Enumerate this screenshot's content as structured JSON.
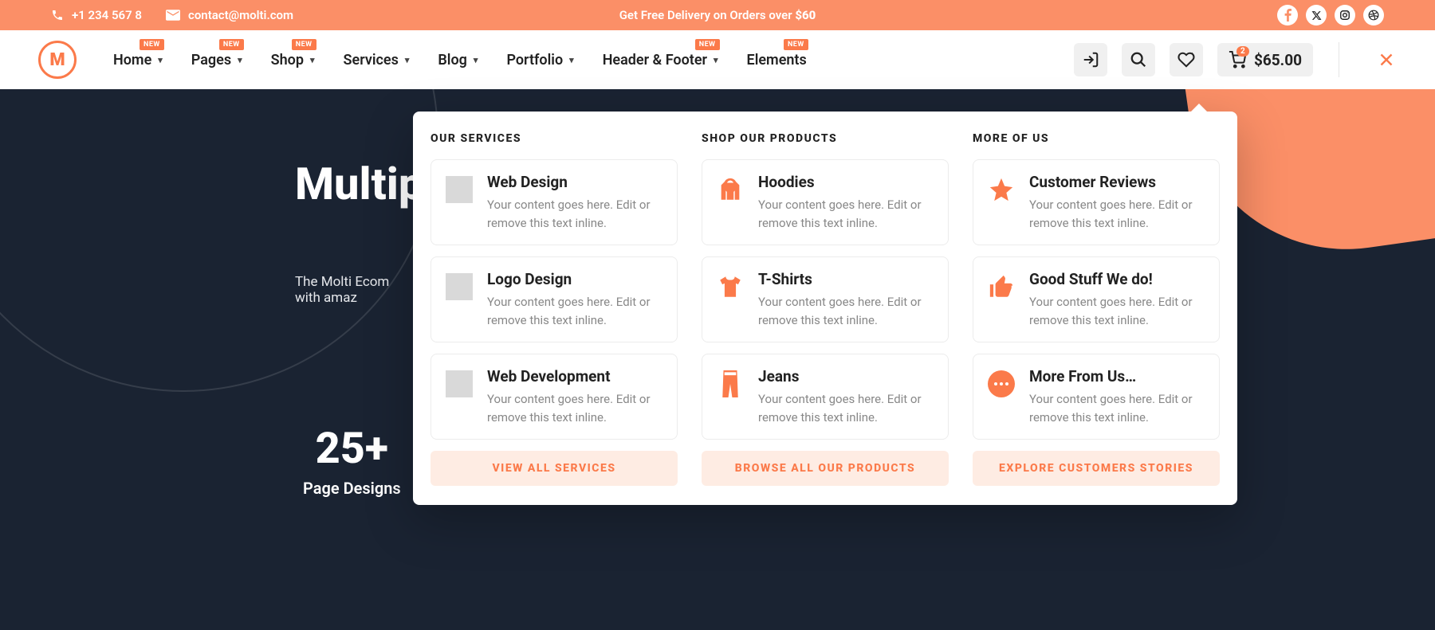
{
  "topbar": {
    "phone": "+1 234 567 8",
    "email": "contact@molti.com",
    "promo_prefix": "Get Free Delivery on Orders over ",
    "promo_amount": "$60"
  },
  "nav": {
    "items": [
      {
        "label": "Home",
        "new": true,
        "caret": true
      },
      {
        "label": "Pages",
        "new": true,
        "caret": true
      },
      {
        "label": "Shop",
        "new": true,
        "caret": true
      },
      {
        "label": "Services",
        "new": false,
        "caret": true
      },
      {
        "label": "Blog",
        "new": false,
        "caret": true
      },
      {
        "label": "Portfolio",
        "new": false,
        "caret": true
      },
      {
        "label": "Header & Footer",
        "new": true,
        "caret": true
      },
      {
        "label": "Elements",
        "new": true,
        "caret": false
      }
    ]
  },
  "cart": {
    "count": "2",
    "total": "$65.00"
  },
  "hero": {
    "title": "Multip",
    "desc1": "The Molti Ecom",
    "desc2": "with amaz",
    "stat_num": "25+",
    "stat_lbl": "Page Designs"
  },
  "mega": {
    "cols": [
      {
        "heading": "OUR SERVICES",
        "icon_mode": "gray",
        "cards": [
          {
            "title": "Web Design",
            "desc": "Your content goes here. Edit or remove this text inline."
          },
          {
            "title": "Logo Design",
            "desc": "Your content goes here. Edit or remove this text inline."
          },
          {
            "title": "Web Development",
            "desc": "Your content goes here. Edit or remove this text inline."
          }
        ],
        "cta": "VIEW ALL SERVICES"
      },
      {
        "heading": "SHOP OUR PRODUCTS",
        "icon_mode": "orange",
        "cards": [
          {
            "title": "Hoodies",
            "icon": "hoodie",
            "desc": "Your content goes here. Edit or remove this text inline."
          },
          {
            "title": "T-Shirts",
            "icon": "tshirt",
            "desc": "Your content goes here. Edit or remove this text inline."
          },
          {
            "title": "Jeans",
            "icon": "jeans",
            "desc": "Your content goes here. Edit or remove this text inline."
          }
        ],
        "cta": "BROWSE ALL OUR PRODUCTS"
      },
      {
        "heading": "MORE OF US",
        "icon_mode": "orange",
        "cards": [
          {
            "title": "Customer Reviews",
            "icon": "star",
            "desc": "Your content goes here. Edit or remove this text inline."
          },
          {
            "title": "Good Stuff We do!",
            "icon": "thumb",
            "desc": "Your content goes here. Edit or remove this text inline."
          },
          {
            "title": "More From Us…",
            "icon": "more",
            "desc": "Your content goes here. Edit or remove this text inline."
          }
        ],
        "cta": "EXPLORE CUSTOMERS STORIES"
      }
    ]
  },
  "badge_text": "NEW"
}
